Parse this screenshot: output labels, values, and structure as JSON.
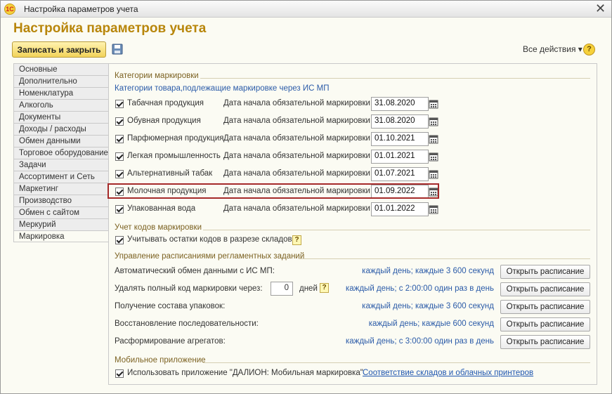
{
  "window": {
    "title": "Настройка параметров учета",
    "logo_text": "1С"
  },
  "header": {
    "page_title": "Настройка параметров учета",
    "save_close_label": "Записать и закрыть",
    "all_actions_label": "Все действия ▾",
    "help_label": "?"
  },
  "tabs": [
    {
      "label": "Основные"
    },
    {
      "label": "Дополнительно"
    },
    {
      "label": "Номенклатура"
    },
    {
      "label": "Алкоголь"
    },
    {
      "label": "Документы"
    },
    {
      "label": "Доходы / расходы"
    },
    {
      "label": "Обмен данными"
    },
    {
      "label": "Торговое оборудование"
    },
    {
      "label": "Задачи"
    },
    {
      "label": "Ассортимент и Сеть"
    },
    {
      "label": "Маркетинг"
    },
    {
      "label": "Производство"
    },
    {
      "label": "Обмен с сайтом"
    },
    {
      "label": "Меркурий"
    },
    {
      "label": "Маркировка"
    }
  ],
  "active_tab": "Маркировка",
  "marking": {
    "section_title": "Категории маркировки",
    "note": "Категории товара,подлежащие маркировке через ИС МП",
    "date_label": "Дата начала обязательной маркировки:",
    "categories": [
      {
        "label": "Табачная продукция",
        "date": "31.08.2020",
        "checked": true
      },
      {
        "label": "Обувная продукция",
        "date": "31.08.2020",
        "checked": true
      },
      {
        "label": "Парфюмерная продукция",
        "date": "01.10.2021",
        "checked": true
      },
      {
        "label": "Легкая промышленность",
        "date": "01.01.2021",
        "checked": true
      },
      {
        "label": "Альтернативный табак",
        "date": "01.07.2021",
        "checked": true
      },
      {
        "label": "Молочная продукция",
        "date": "01.09.2022",
        "checked": true
      },
      {
        "label": "Упакованная вода",
        "date": "01.01.2022",
        "checked": true
      }
    ]
  },
  "codes": {
    "section_title": "Учет кодов маркировки",
    "checkbox_label": "Учитывать остатки кодов в разрезе складов",
    "hint": "?"
  },
  "schedules": {
    "section_title": "Управление расписаниями регламентных заданий",
    "button_label": "Открыть расписание",
    "days_label": "дней",
    "days_value": "0",
    "hint": "?",
    "rows": [
      {
        "label": "Автоматический обмен данными с ИС МП:",
        "schedule": "каждый день; каждые 3 600 секунд"
      },
      {
        "label": "Удалять полный код маркировки через:",
        "schedule": "каждый день; с 2:00:00 один раз в день"
      },
      {
        "label": "Получение состава упаковок:",
        "schedule": "каждый день; каждые 3 600 секунд"
      },
      {
        "label": "Восстановление последовательности:",
        "schedule": "каждый день; каждые 600 секунд"
      },
      {
        "label": "Расформирование агрегатов:",
        "schedule": "каждый день; с 3:00:00 один раз в день"
      }
    ]
  },
  "mobile": {
    "section_title": "Мобильное приложение",
    "checkbox_label": "Использовать приложение \"ДАЛИОН: Мобильная маркировка\"",
    "link_label": "Соответствие складов и облачных принтеров"
  },
  "colors": {
    "accent": "#b8860b",
    "link": "#2b5ba8",
    "highlight": "#a52a2a"
  }
}
